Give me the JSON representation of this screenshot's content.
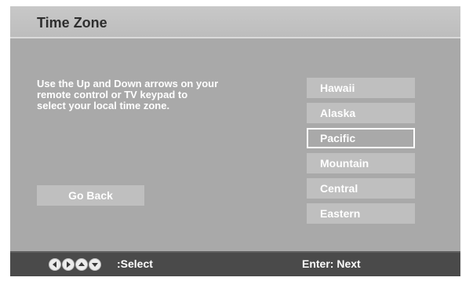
{
  "header": {
    "title": "Time Zone"
  },
  "instructions": "Use the Up and Down arrows on your\nremote control or TV keypad to\nselect your local time zone.",
  "buttons": {
    "go_back": "Go Back"
  },
  "time_zones": [
    {
      "label": "Hawaii",
      "selected": false
    },
    {
      "label": "Alaska",
      "selected": false
    },
    {
      "label": "Pacific",
      "selected": true
    },
    {
      "label": "Mountain",
      "selected": false
    },
    {
      "label": "Central",
      "selected": false
    },
    {
      "label": "Eastern",
      "selected": false
    }
  ],
  "footer": {
    "select_label": ":Select",
    "enter_label": "Enter: Next",
    "arrow_icons": [
      "left-arrow-icon",
      "right-arrow-icon",
      "up-arrow-icon",
      "down-arrow-icon"
    ]
  },
  "colors": {
    "panel": "#a9a9a9",
    "title_bar": "#c2c2c2",
    "item": "#bfbfbf",
    "footer": "#4a4a4a",
    "text": "#ffffff"
  }
}
